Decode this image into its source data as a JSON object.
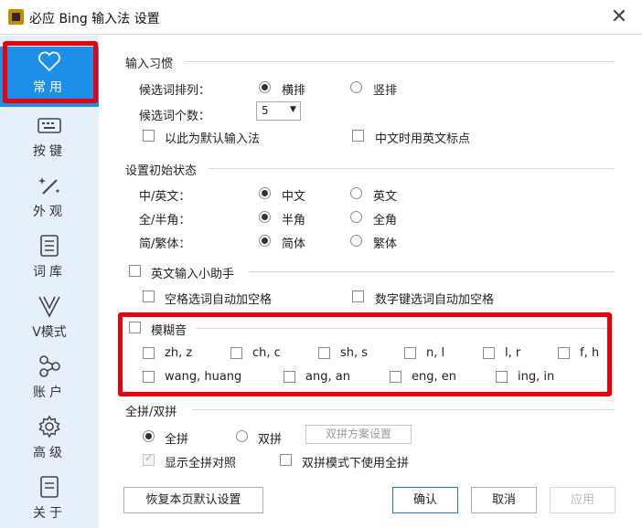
{
  "window": {
    "title": "必应 Bing 输入法 设置",
    "close": "✕"
  },
  "sidebar": {
    "items": [
      {
        "label": "常用",
        "icon": "heart-icon"
      },
      {
        "label": "按键",
        "icon": "keyboard-icon"
      },
      {
        "label": "外观",
        "icon": "magic-wand-icon"
      },
      {
        "label": "词库",
        "icon": "document-icon"
      },
      {
        "label": "V模式",
        "icon": "v-icon"
      },
      {
        "label": "账户",
        "icon": "share-nodes-icon"
      },
      {
        "label": "高级",
        "icon": "gear-icon"
      },
      {
        "label": "关于",
        "icon": "document-lines-icon"
      }
    ],
    "selected": "常用",
    "highlight_color": "#e8000b"
  },
  "habits": {
    "title": "输入习惯",
    "arrange_label": "候选词排列：",
    "horizontal": "横排",
    "vertical": "竖排",
    "count_label": "候选词个数：",
    "count_value": "5",
    "default_ime": "以此为默认输入法",
    "en_punct": "中文时用英文标点"
  },
  "initial": {
    "title": "设置初始状态",
    "cn_en_label": "中/英文：",
    "cn": "中文",
    "en": "英文",
    "width_label": "全/半角：",
    "half": "半角",
    "full": "全角",
    "script_label": "简/繁体：",
    "simplified": "简体",
    "traditional": "繁体"
  },
  "helper": {
    "title": "英文输入小助手",
    "space_after": "空格选词自动加空格",
    "digit_space": "数字键选词自动加空格"
  },
  "fuzzy": {
    "title": "模糊音",
    "row1": [
      "zh, z",
      "ch, c",
      "sh, s",
      "n, l",
      "l, r",
      "f, h"
    ],
    "row2": [
      "wang, huang",
      "ang, an",
      "eng, en",
      "ing, in"
    ]
  },
  "pinyin": {
    "title": "全拼/双拼",
    "full": "全拼",
    "double": "双拼",
    "scheme_btn": "双拼方案设置",
    "show_full": "显示全拼对照",
    "double_use_full": "双拼模式下使用全拼"
  },
  "footer": {
    "restore": "恢复本页默认设置",
    "ok": "确认",
    "cancel": "取消",
    "apply": "应用"
  }
}
